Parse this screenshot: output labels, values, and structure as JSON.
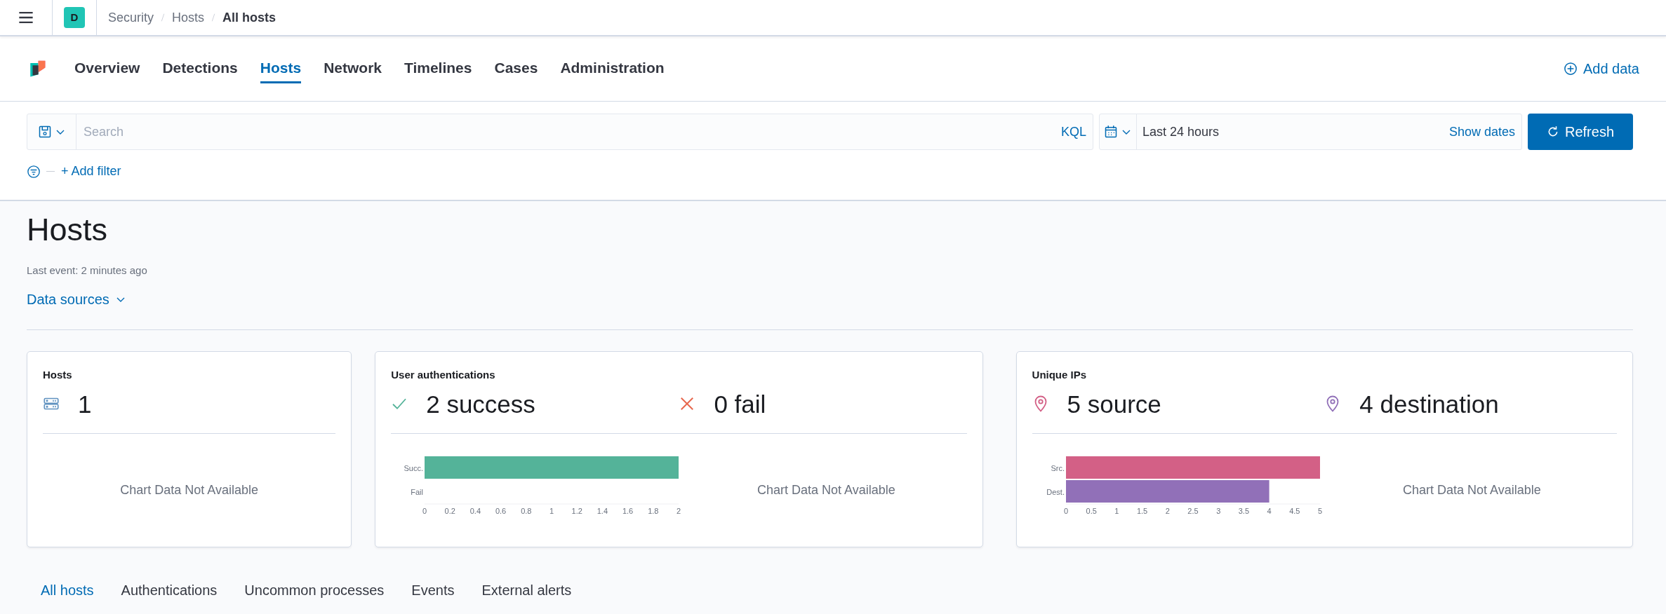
{
  "header": {
    "space_initial": "D",
    "breadcrumbs": [
      "Security",
      "Hosts",
      "All hosts"
    ]
  },
  "nav": {
    "tabs": [
      {
        "label": "Overview",
        "selected": false
      },
      {
        "label": "Detections",
        "selected": false
      },
      {
        "label": "Hosts",
        "selected": true
      },
      {
        "label": "Network",
        "selected": false
      },
      {
        "label": "Timelines",
        "selected": false
      },
      {
        "label": "Cases",
        "selected": false
      },
      {
        "label": "Administration",
        "selected": false
      }
    ],
    "add_data": "Add data"
  },
  "query_bar": {
    "placeholder": "Search",
    "language": "KQL",
    "date_range": "Last 24 hours",
    "show_dates": "Show dates",
    "refresh": "Refresh",
    "add_filter": "+ Add filter"
  },
  "page": {
    "title": "Hosts",
    "last_event": "Last event: 2 minutes ago",
    "data_sources": "Data sources"
  },
  "cards": [
    {
      "title": "Hosts",
      "stats": [
        {
          "kind": "host",
          "color": "#6092c0",
          "value": "1"
        }
      ],
      "panels": [
        {
          "message": "Chart Data Not Available"
        }
      ]
    },
    {
      "title": "User authentications",
      "stats": [
        {
          "kind": "check",
          "color": "#54b399",
          "value": "2 success"
        },
        {
          "kind": "cross",
          "color": "#e7664c",
          "value": "0 fail"
        }
      ],
      "panels": [
        {
          "chart_data": {
            "type": "bar",
            "orientation": "horizontal",
            "categories": [
              "Succ.",
              "Fail"
            ],
            "series": [
              {
                "color": "#54b399",
                "values": [
                  2,
                  0
                ]
              }
            ],
            "xlim": [
              0,
              2
            ],
            "xticks": [
              0,
              0.2,
              0.4,
              0.6,
              0.8,
              1,
              1.2,
              1.4,
              1.6,
              1.8,
              2
            ]
          }
        },
        {
          "message": "Chart Data Not Available"
        }
      ]
    },
    {
      "title": "Unique IPs",
      "stats": [
        {
          "kind": "pin",
          "color": "#d36086",
          "value": "5 source"
        },
        {
          "kind": "pin",
          "color": "#9170b8",
          "value": "4 destination"
        }
      ],
      "panels": [
        {
          "chart_data": {
            "type": "bar",
            "orientation": "horizontal",
            "categories": [
              "Src.",
              "Dest."
            ],
            "series": [
              {
                "color": "#d36086",
                "values": [
                  5,
                  null
                ]
              },
              {
                "color": "#9170b8",
                "values": [
                  null,
                  4
                ]
              }
            ],
            "xlim": [
              0,
              5
            ],
            "xticks": [
              0,
              0.5,
              1,
              1.5,
              2,
              2.5,
              3,
              3.5,
              4,
              4.5,
              5
            ]
          }
        },
        {
          "message": "Chart Data Not Available"
        }
      ]
    }
  ],
  "tabs": [
    {
      "label": "All hosts",
      "selected": true
    },
    {
      "label": "Authentications",
      "selected": false
    },
    {
      "label": "Uncommon processes",
      "selected": false
    },
    {
      "label": "Events",
      "selected": false
    },
    {
      "label": "External alerts",
      "selected": false
    }
  ]
}
